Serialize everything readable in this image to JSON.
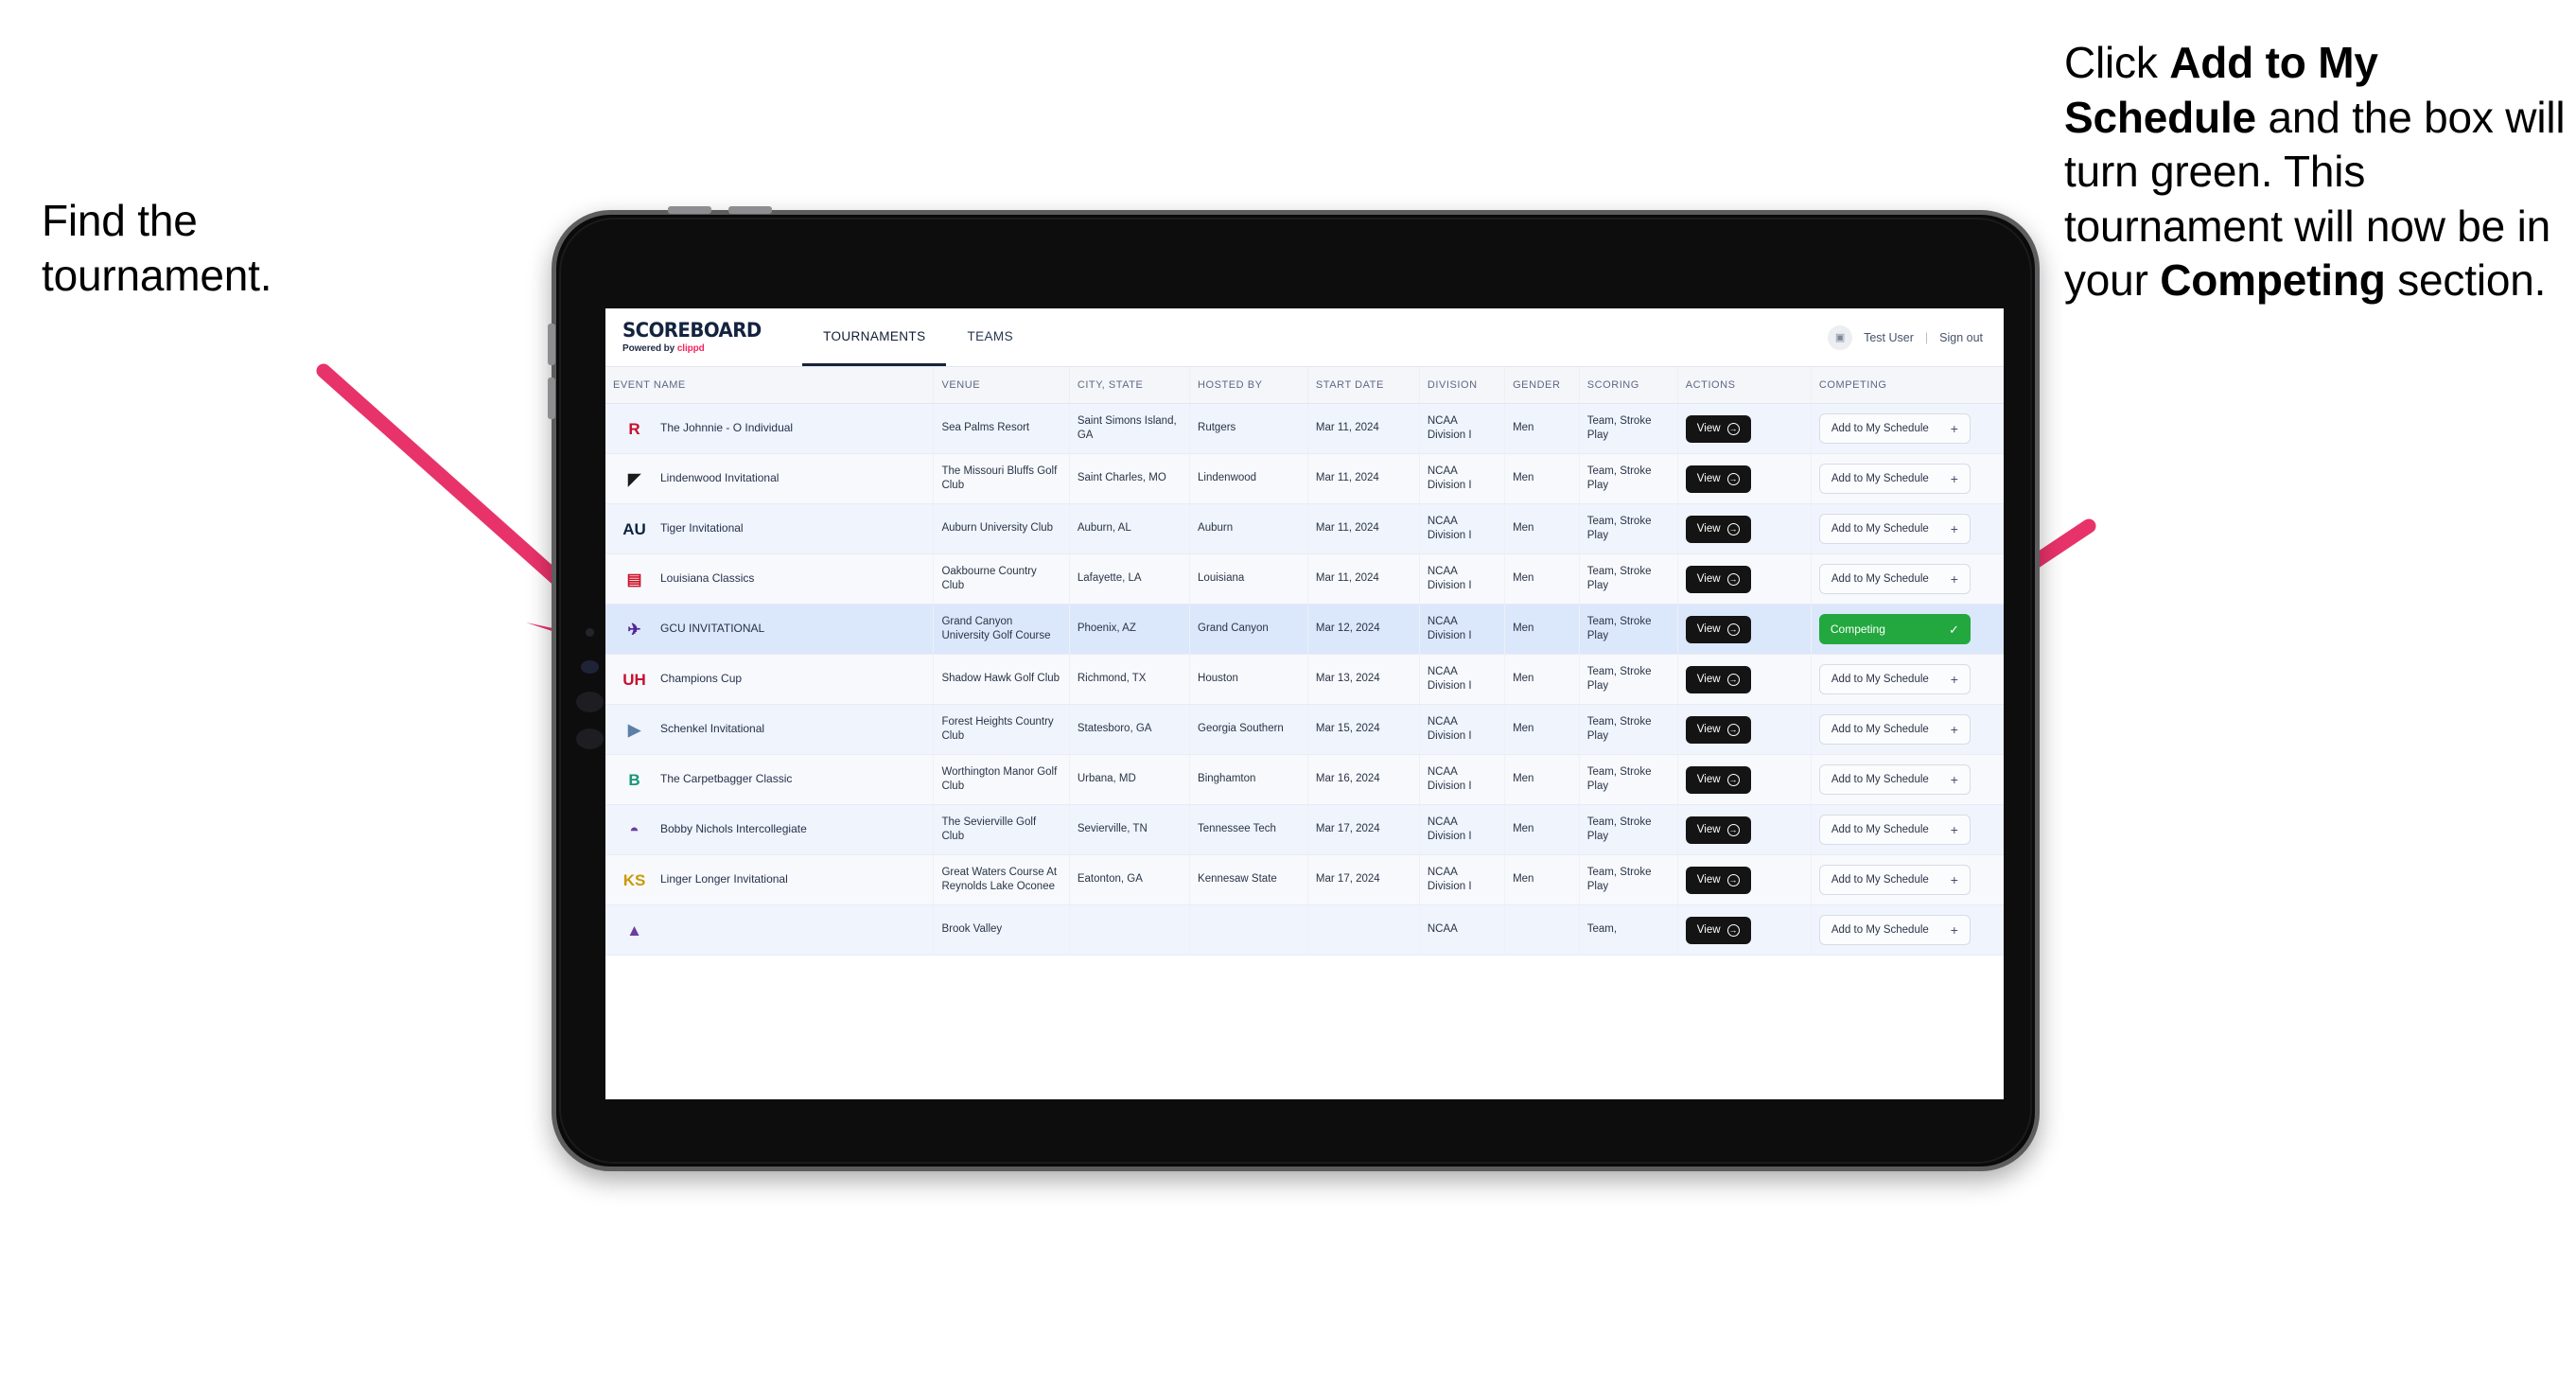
{
  "annotations": {
    "left": {
      "line1": "Find the",
      "line2": "tournament."
    },
    "right": {
      "seg1": "Click ",
      "bold1": "Add to My Schedule",
      "seg2": " and the box will turn green. This tournament will now be in your ",
      "bold2": "Competing",
      "seg3": " section."
    }
  },
  "colors": {
    "arrow": "#e8336a",
    "competing_green": "#22a83f",
    "view_black": "#141414",
    "selected_row": "#dbe7fb",
    "brand_accent": "#f3245f"
  },
  "app": {
    "brand": {
      "title": "SCOREBOARD",
      "powered_prefix": "Powered by ",
      "powered_brand": "clippd"
    },
    "tabs": [
      {
        "label": "TOURNAMENTS",
        "active": true
      },
      {
        "label": "TEAMS",
        "active": false
      }
    ],
    "user": {
      "avatar_glyph": "▣",
      "name": "Test User",
      "separator": "|",
      "sign_out": "Sign out"
    },
    "table": {
      "columns": [
        "EVENT NAME",
        "VENUE",
        "CITY, STATE",
        "HOSTED BY",
        "START DATE",
        "DIVISION",
        "GENDER",
        "SCORING",
        "ACTIONS",
        "COMPETING"
      ],
      "action_label": "View",
      "add_label": "Add to My Schedule",
      "add_icon": "+",
      "competing_label": "Competing",
      "competing_icon": "✓",
      "rows": [
        {
          "logo_text": "R",
          "logo_color": "#c8102e",
          "event": "The Johnnie - O Individual",
          "venue": "Sea Palms Resort",
          "city": "Saint Simons Island, GA",
          "host": "Rutgers",
          "date": "Mar 11, 2024",
          "division": "NCAA Division I",
          "gender": "Men",
          "scoring": "Team, Stroke Play",
          "competing": false
        },
        {
          "logo_text": "◤",
          "logo_color": "#1a1a1a",
          "event": "Lindenwood Invitational",
          "venue": "The Missouri Bluffs Golf Club",
          "city": "Saint Charles, MO",
          "host": "Lindenwood",
          "date": "Mar 11, 2024",
          "division": "NCAA Division I",
          "gender": "Men",
          "scoring": "Team, Stroke Play",
          "competing": false
        },
        {
          "logo_text": "AU",
          "logo_color": "#0c2340",
          "event": "Tiger Invitational",
          "venue": "Auburn University Club",
          "city": "Auburn, AL",
          "host": "Auburn",
          "date": "Mar 11, 2024",
          "division": "NCAA Division I",
          "gender": "Men",
          "scoring": "Team, Stroke Play",
          "competing": false
        },
        {
          "logo_text": "▤",
          "logo_color": "#ce1126",
          "event": "Louisiana Classics",
          "venue": "Oakbourne Country Club",
          "city": "Lafayette, LA",
          "host": "Louisiana",
          "date": "Mar 11, 2024",
          "division": "NCAA Division I",
          "gender": "Men",
          "scoring": "Team, Stroke Play",
          "competing": false
        },
        {
          "logo_text": "✈",
          "logo_color": "#522398",
          "event": "GCU INVITATIONAL",
          "venue": "Grand Canyon University Golf Course",
          "city": "Phoenix, AZ",
          "host": "Grand Canyon",
          "date": "Mar 12, 2024",
          "division": "NCAA Division I",
          "gender": "Men",
          "scoring": "Team, Stroke Play",
          "competing": true,
          "selected": true
        },
        {
          "logo_text": "UH",
          "logo_color": "#c8102e",
          "event": "Champions Cup",
          "venue": "Shadow Hawk Golf Club",
          "city": "Richmond, TX",
          "host": "Houston",
          "date": "Mar 13, 2024",
          "division": "NCAA Division I",
          "gender": "Men",
          "scoring": "Team, Stroke Play",
          "competing": false
        },
        {
          "logo_text": "▶",
          "logo_color": "#5b7fa6",
          "event": "Schenkel Invitational",
          "venue": "Forest Heights Country Club",
          "city": "Statesboro, GA",
          "host": "Georgia Southern",
          "date": "Mar 15, 2024",
          "division": "NCAA Division I",
          "gender": "Men",
          "scoring": "Team, Stroke Play",
          "competing": false
        },
        {
          "logo_text": "B",
          "logo_color": "#16967a",
          "event": "The Carpetbagger Classic",
          "venue": "Worthington Manor Golf Club",
          "city": "Urbana, MD",
          "host": "Binghamton",
          "date": "Mar 16, 2024",
          "division": "NCAA Division I",
          "gender": "Men",
          "scoring": "Team, Stroke Play",
          "competing": false
        },
        {
          "logo_text": "◓",
          "logo_color": "#6a3fa0",
          "event": "Bobby Nichols Intercollegiate",
          "venue": "The Sevierville Golf Club",
          "city": "Sevierville, TN",
          "host": "Tennessee Tech",
          "date": "Mar 17, 2024",
          "division": "NCAA Division I",
          "gender": "Men",
          "scoring": "Team, Stroke Play",
          "competing": false
        },
        {
          "logo_text": "KS",
          "logo_color": "#cc9900",
          "event": "Linger Longer Invitational",
          "venue": "Great Waters Course At Reynolds Lake Oconee",
          "city": "Eatonton, GA",
          "host": "Kennesaw State",
          "date": "Mar 17, 2024",
          "division": "NCAA Division I",
          "gender": "Men",
          "scoring": "Team, Stroke Play",
          "competing": false
        },
        {
          "logo_text": "▲",
          "logo_color": "#6a3fa0",
          "event": "",
          "venue": "Brook Valley",
          "city": "",
          "host": "",
          "date": "",
          "division": "NCAA",
          "gender": "",
          "scoring": "Team,",
          "competing": false,
          "clipped": true
        }
      ]
    }
  }
}
